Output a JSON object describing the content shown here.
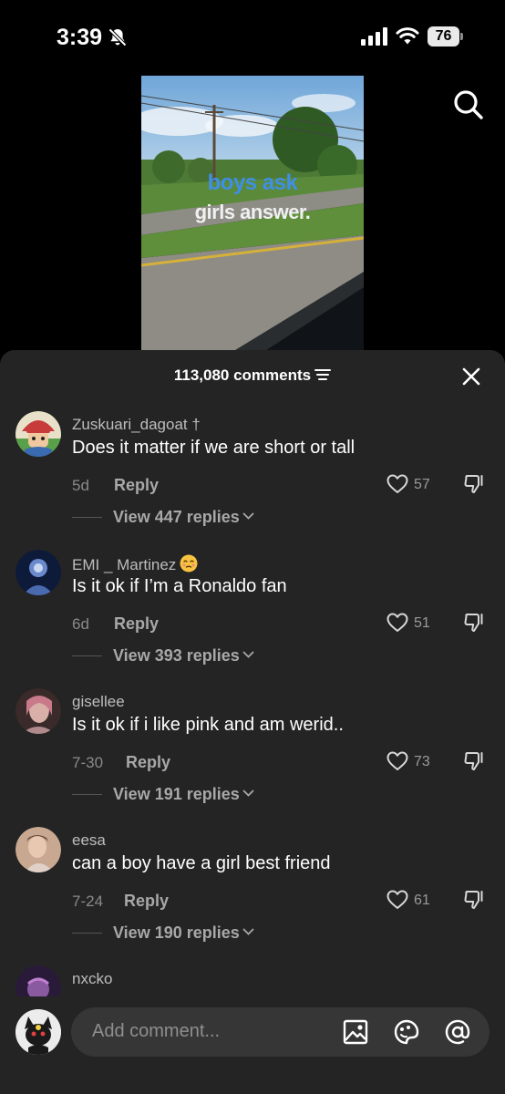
{
  "status_bar": {
    "time": "3:39",
    "battery": "76",
    "icons": [
      "bell-slash-icon",
      "cellular-signal-icon",
      "wifi-icon",
      "battery-icon"
    ]
  },
  "video": {
    "overlay_line1": "boys ask",
    "overlay_line2": "girls answer.",
    "overlay_line1_color": "#3f8fe6",
    "search_icon": "search-icon"
  },
  "comments_sheet": {
    "count_label": "113,080 comments",
    "sort_icon": "sort-lines-icon",
    "close_icon": "close-icon",
    "comments": [
      {
        "username": "Zuskuari_dagoat †",
        "text": "Does it matter if we are short or tall",
        "time": "5d",
        "reply_label": "Reply",
        "likes": "57",
        "view_replies": "View 447 replies"
      },
      {
        "username": "EMI _ Martinez",
        "emoji": "pleading-face-emoji",
        "text": "Is it ok if I’m a Ronaldo fan",
        "time": "6d",
        "reply_label": "Reply",
        "likes": "51",
        "view_replies": "View 393 replies"
      },
      {
        "username": "gisellee",
        "text": "Is it ok if i like pink and am werid..",
        "time": "7-30",
        "reply_label": "Reply",
        "likes": "73",
        "view_replies": "View 191 replies"
      },
      {
        "username": "eesa",
        "text": "can a boy have a girl best friend",
        "time": "7-24",
        "reply_label": "Reply",
        "likes": "61",
        "view_replies": "View 190 replies"
      },
      {
        "username": "nxcko"
      }
    ]
  },
  "input_bar": {
    "placeholder": "Add comment...",
    "icons": [
      "image-icon",
      "sticker-icon",
      "mention-icon"
    ]
  },
  "colors": {
    "sheet_background": "#242424",
    "input_background": "#363636",
    "secondary_text": "#a8a8a8"
  }
}
